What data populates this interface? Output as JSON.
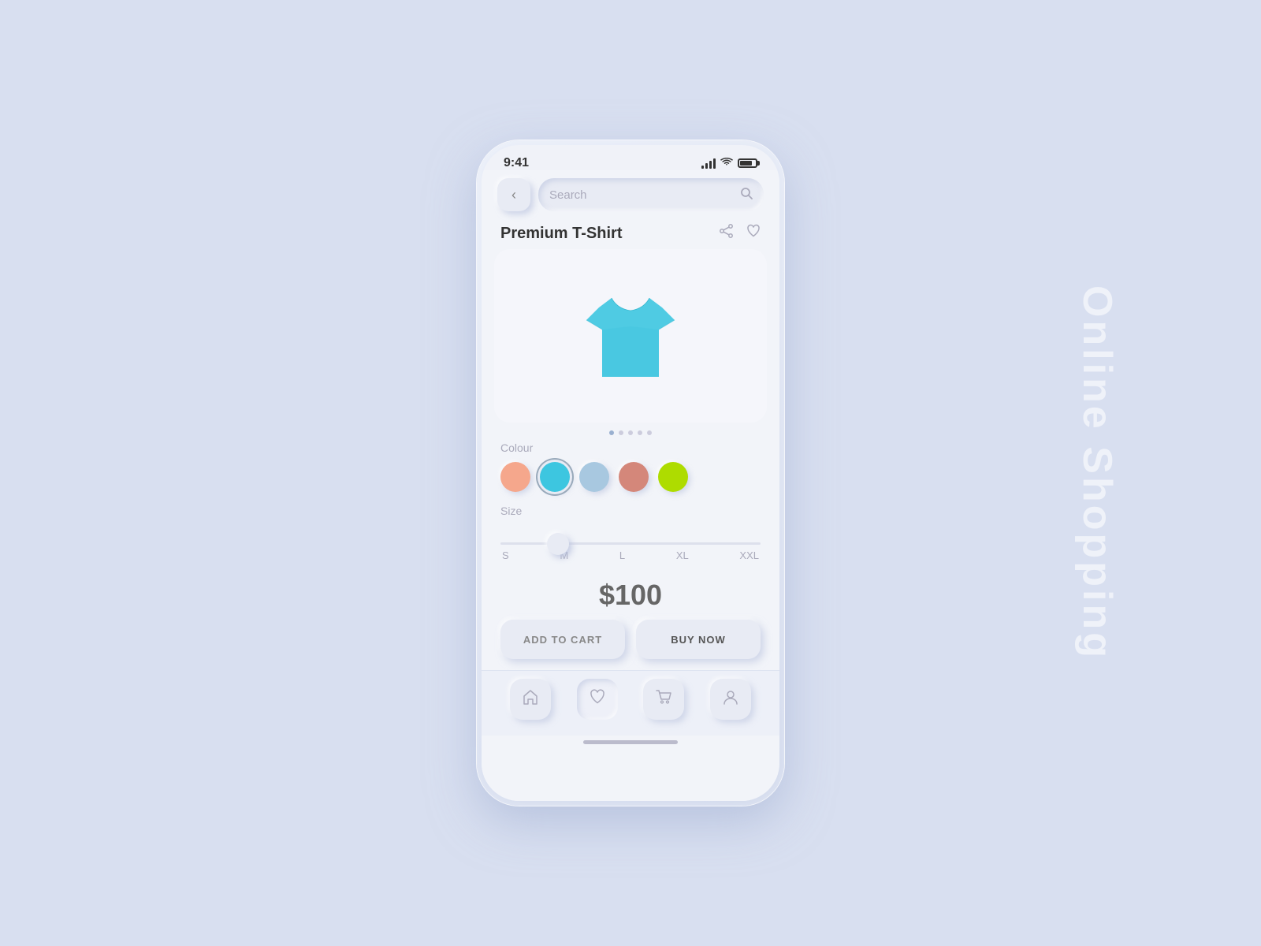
{
  "watermark": {
    "text": "Online Shopping"
  },
  "status_bar": {
    "time": "9:41",
    "signal": "signal",
    "wifi": "wifi",
    "battery": "battery"
  },
  "search": {
    "placeholder": "Search"
  },
  "product": {
    "title": "Premium T-Shirt",
    "price": "$100",
    "colors": [
      {
        "name": "peach",
        "hex": "#F5A78C",
        "selected": false
      },
      {
        "name": "cyan",
        "hex": "#3DC6E0",
        "selected": true
      },
      {
        "name": "light-blue",
        "hex": "#A8C8E0",
        "selected": false
      },
      {
        "name": "rose",
        "hex": "#D4877A",
        "selected": false
      },
      {
        "name": "lime",
        "hex": "#AEDC00",
        "selected": false
      }
    ],
    "sizes": [
      "S",
      "M",
      "L",
      "XL",
      "XXL"
    ],
    "selected_size": "M",
    "colour_label": "Colour",
    "size_label": "Size"
  },
  "buttons": {
    "add_to_cart": "ADD TO CART",
    "buy_now": "BUY NOW"
  },
  "pagination": {
    "dots": 5,
    "active": 0
  },
  "nav": {
    "items": [
      {
        "name": "home",
        "icon": "home",
        "active": false
      },
      {
        "name": "favorites",
        "icon": "heart",
        "active": true
      },
      {
        "name": "cart",
        "icon": "cart",
        "active": false
      },
      {
        "name": "profile",
        "icon": "person",
        "active": false
      }
    ]
  }
}
